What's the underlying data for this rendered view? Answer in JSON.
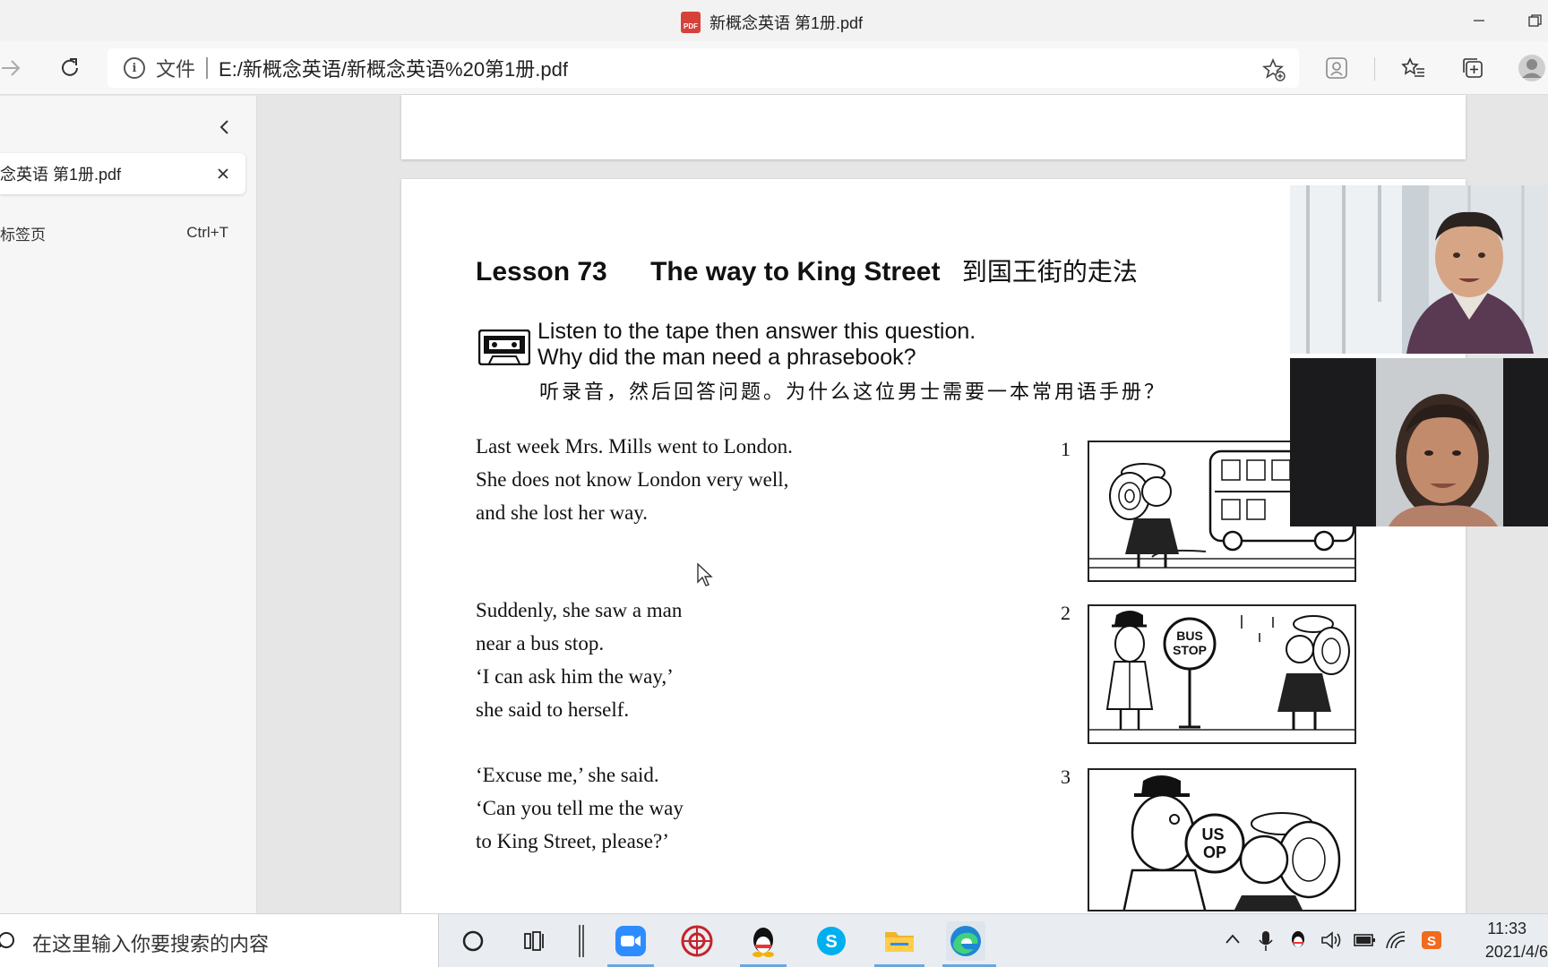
{
  "window": {
    "title": "新概念英语 第1册.pdf",
    "pdf_badge": "PDF"
  },
  "addressbar": {
    "scheme_label": "文件",
    "url": "E:/新概念英语/新概念英语%20第1册.pdf"
  },
  "sidebar": {
    "tab_label": "念英语 第1册.pdf",
    "new_tab_label": "标签页",
    "new_tab_shortcut": "Ctrl+T"
  },
  "pdf": {
    "lesson_number": "Lesson 73",
    "lesson_title_en": "The way to King Street",
    "lesson_title_zh": "到国王街的走法",
    "question_line1": "Listen to the tape then answer this question.",
    "question_line2": "Why did the man need a phrasebook?",
    "question_zh": "听录音，然后回答问题。为什么这位男士需要一本常用语手册？",
    "paragraphs": [
      {
        "number": "1",
        "lines": [
          "Last week Mrs. Mills went to London.",
          "She does not know London very well,",
          "and she lost her way."
        ]
      },
      {
        "number": "2",
        "lines": [
          "Suddenly, she saw a man",
          "near a bus stop.",
          "‘I can ask him the way,’",
          "she said to herself."
        ]
      },
      {
        "number": "3",
        "lines": [
          "‘Excuse me,’ she said.",
          "‘Can you tell me the way",
          "to King Street, please?’"
        ]
      }
    ],
    "bus_stop_sign": [
      "BUS",
      "STOP"
    ],
    "bus_stop_sign_partial": [
      "US",
      "OP"
    ]
  },
  "taskbar": {
    "search_placeholder": "在这里输入你要搜索的内容",
    "time": "11:33",
    "date": "2021/4/6"
  },
  "colors": {
    "accent": "#6aa7e0",
    "pdf_red": "#d6423a",
    "page_bg": "#e6e6e6"
  }
}
